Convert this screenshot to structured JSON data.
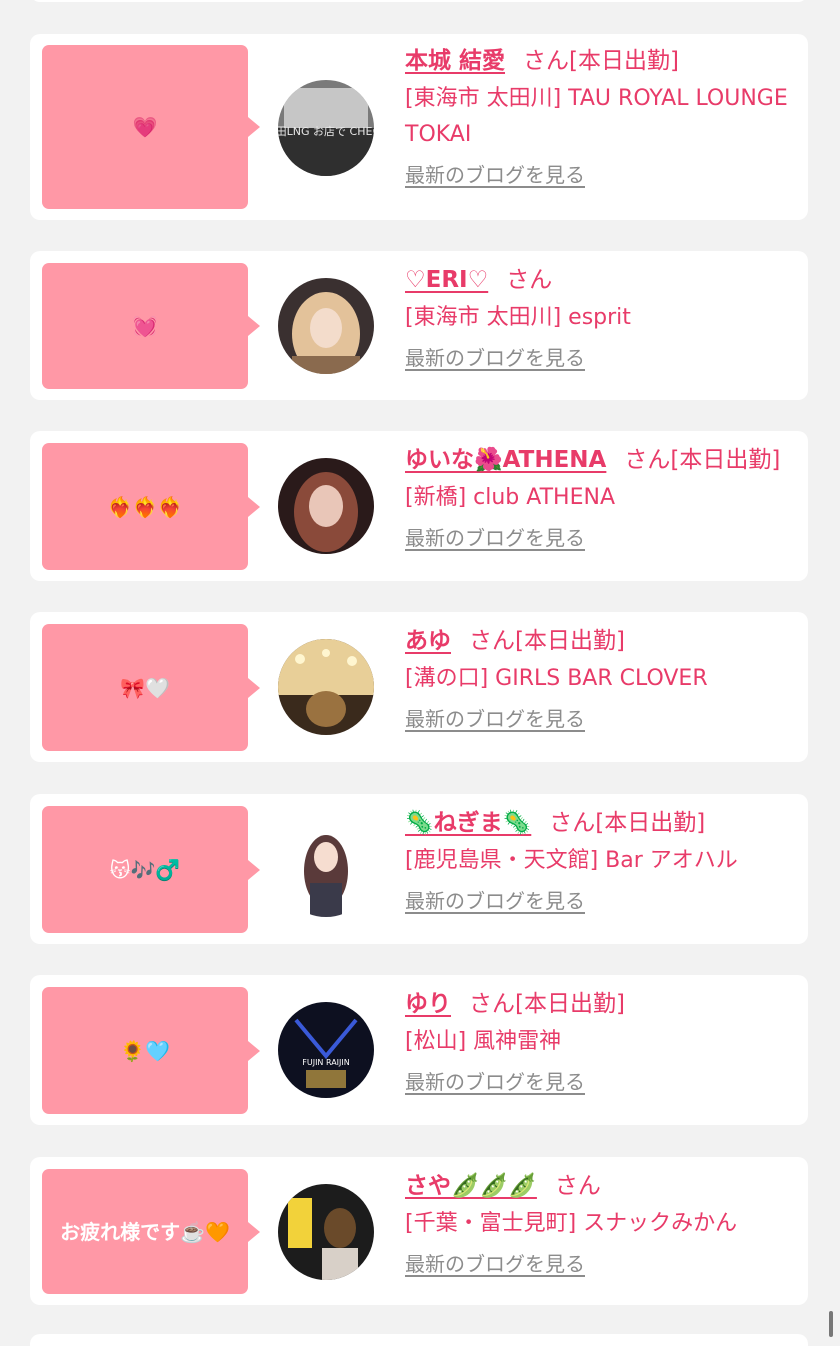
{
  "entries": [
    {
      "message": "💗",
      "name": "本城 結愛",
      "suffix": "さん[本日出勤]",
      "shop": "[東海市 太田川] TAU ROYAL LOUNGE TOKAI",
      "blog_link": "最新のブログを見る",
      "avatar_colors": [
        "#dadada",
        "#7a7a7a",
        "#2f2f2f"
      ],
      "avatar_text": "創田LNG お店で CHECK"
    },
    {
      "message": "💓",
      "name": "♡ERI♡",
      "suffix": "さん",
      "shop": "[東海市 太田川] esprit",
      "blog_link": "最新のブログを見る",
      "avatar_colors": [
        "#e3c29a",
        "#8a6a4e",
        "#3a3030"
      ]
    },
    {
      "message": "❤️‍🔥❤️‍🔥❤️‍🔥",
      "name": "ゆいな🌺ATHENA",
      "suffix": "さん[本日出勤]",
      "shop": "[新橋] club ATHENA",
      "blog_link": "最新のブログを見る",
      "avatar_colors": [
        "#e9c6b8",
        "#8a4a3a",
        "#2a1a1a"
      ]
    },
    {
      "message": "🎀🤍",
      "name": "あゆ",
      "suffix": "さん[本日出勤]",
      "shop": "[溝の口] GIRLS BAR CLOVER",
      "blog_link": "最新のブログを見る",
      "avatar_colors": [
        "#e8cf98",
        "#9a7240",
        "#3a2a1c"
      ]
    },
    {
      "message": "😽🎶♂️",
      "name": "🦠ねぎま🦠",
      "suffix": "さん[本日出勤]",
      "shop": "[鹿児島県・天文館] Bar アオハル",
      "blog_link": "最新のブログを見る",
      "avatar_colors": [
        "#ffffff",
        "#f4f4f4",
        "#5a3a3a"
      ]
    },
    {
      "message": "🌻🩵",
      "name": "ゆり",
      "suffix": "さん[本日出勤]",
      "shop": "[松山] 風神雷神",
      "blog_link": "最新のブログを見る",
      "avatar_colors": [
        "#0d1020",
        "#3a5ad8",
        "#c9a246"
      ],
      "avatar_text": "FUJIN RAIJIN"
    },
    {
      "message": "お疲れ様です☕️🧡",
      "name": "さや🫛🫛🫛",
      "suffix": "さん",
      "shop": "[千葉・富士見町] スナックみかん",
      "blog_link": "最新のブログを見る",
      "avatar_colors": [
        "#f2d23a",
        "#6a4a2a",
        "#1c1c1c"
      ]
    }
  ]
}
